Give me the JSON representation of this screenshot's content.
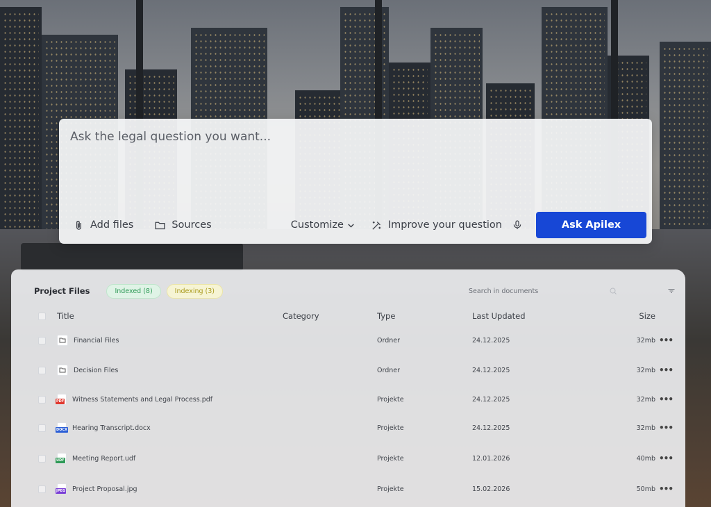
{
  "ask": {
    "placeholder": "Ask the legal question you want...",
    "add_files_label": "Add files",
    "sources_label": "Sources",
    "customize_label": "Customize",
    "improve_label": "Improve your question",
    "submit_label": "Ask Apilex",
    "submit_color": "#1747d6"
  },
  "files": {
    "title": "Project Files",
    "badges": {
      "indexed": "Indexed (8)",
      "indexing": "Indexing (3)"
    },
    "search_placeholder": "Search in documents",
    "columns": {
      "title": "Title",
      "category": "Category",
      "type": "Type",
      "updated": "Last Updated",
      "size": "Size"
    },
    "rows": [
      {
        "name": "Financial Files",
        "icon": "folder-icon",
        "type": "Ordner",
        "updated": "24.12.2025",
        "size": "32mb"
      },
      {
        "name": "Decision Files",
        "icon": "folder-icon",
        "type": "Ordner",
        "updated": "24.12.2025",
        "size": "32mb"
      },
      {
        "name": "Witness Statements and Legal Process.pdf",
        "icon": "pdf-file-icon",
        "tag": "PDF",
        "tag_color": "#e0392f",
        "type": "Projekte",
        "updated": "24.12.2025",
        "size": "32mb"
      },
      {
        "name": "Hearing Transcript.docx",
        "icon": "docx-file-icon",
        "tag": "DOCX",
        "tag_color": "#2c5fd6",
        "type": "Projekte",
        "updated": "24.12.2025",
        "size": "32mb"
      },
      {
        "name": "Meeting Report.udf",
        "icon": "udf-file-icon",
        "tag": "UDF",
        "tag_color": "#2f9a57",
        "type": "Projekte",
        "updated": "12.01.2026",
        "size": "40mb"
      },
      {
        "name": "Project Proposal.jpg",
        "icon": "jpg-file-icon",
        "tag": "JPEG",
        "tag_color": "#7a3fd6",
        "type": "Projekte",
        "updated": "15.02.2026",
        "size": "50mb"
      }
    ]
  }
}
